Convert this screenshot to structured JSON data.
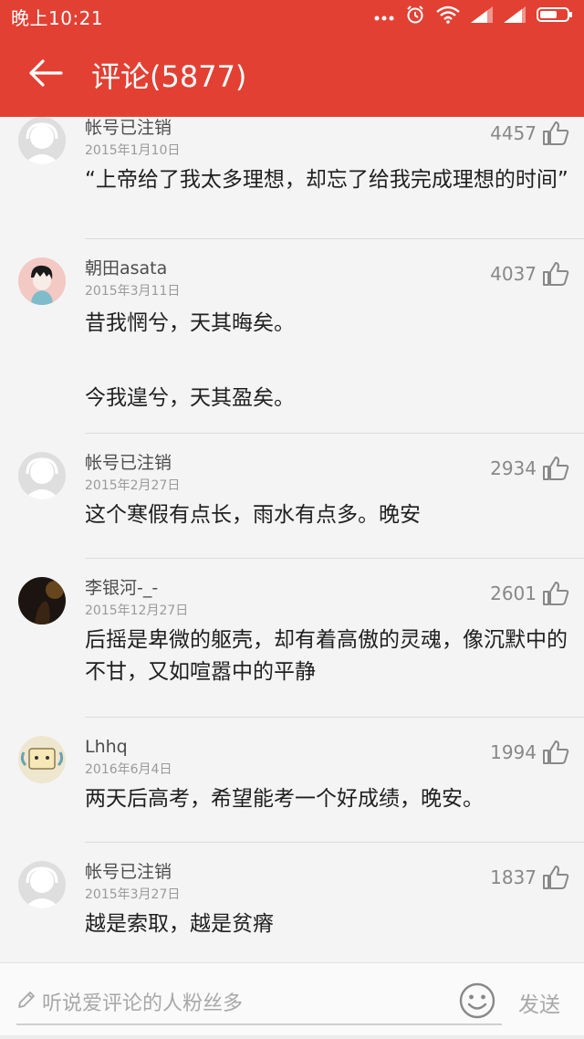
{
  "status_bar": {
    "time": "晚上10:21",
    "icons": [
      "sim-dots-icon",
      "alarm-icon",
      "wifi-icon",
      "signal-icon",
      "signal-icon",
      "battery-icon"
    ]
  },
  "toolbar": {
    "back_icon": "back-arrow-icon",
    "title": "评论(5877)"
  },
  "colors": {
    "brand": "#e24033",
    "like_icon": "#888888"
  },
  "comments": [
    {
      "username": "帐号已注销",
      "date": "2015年1月10日",
      "likes": "4457",
      "text": "“上帝给了我太多理想，却忘了给我完成理想的时间”",
      "avatar": "default-avatar-icon"
    },
    {
      "username": "朝田asata",
      "date": "2015年3月11日",
      "likes": "4037",
      "text": "昔我惘兮，天其晦矣。\n\n今我遑兮，天其盈矣。",
      "avatar": "cartoon-boy-avatar"
    },
    {
      "username": "帐号已注销",
      "date": "2015年2月27日",
      "likes": "2934",
      "text": "这个寒假有点长，雨水有点多。晚安",
      "avatar": "default-avatar-icon"
    },
    {
      "username": "李银河-_-",
      "date": "2015年12月27日",
      "likes": "2601",
      "text": "后摇是卑微的躯壳，却有着高傲的灵魂，像沉默中的不甘，又如喧嚣中的平静",
      "avatar": "dark-photo-avatar"
    },
    {
      "username": "Lhhq",
      "date": "2016年6月4日",
      "likes": "1994",
      "text": "两天后高考，希望能考一个好成绩，晚安。",
      "avatar": "cat-avatar"
    },
    {
      "username": "帐号已注销",
      "date": "2015年3月27日",
      "likes": "1837",
      "text": "越是索取，越是贫瘠",
      "avatar": "default-avatar-icon"
    }
  ],
  "input_bar": {
    "pencil_icon": "pencil-icon",
    "placeholder": "听说爱评论的人粉丝多",
    "emoji_icon": "smiley-icon",
    "send_label": "发送"
  }
}
